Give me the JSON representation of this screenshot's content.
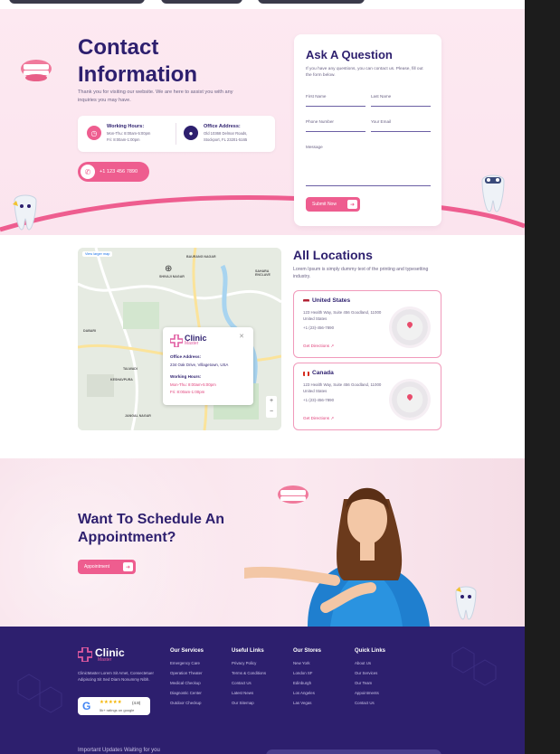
{
  "contact": {
    "title_line1": "Contact",
    "title_line2": "Information",
    "subtitle": "Thank you for visiting our website. We are here to assist you with any inquiries you may have.",
    "working_hours": {
      "title": "Working Hours:",
      "line1": "Mon-Thu: 8:00am-5:00pm",
      "line2": "Fri: 8:00am-1:00pm"
    },
    "office_address": {
      "title": "Office Address:",
      "line1": "Old 10368 Delmar Roads,",
      "line2": "Stockport, FL 23201-5165"
    },
    "phone": "+1 123 456 7890"
  },
  "form": {
    "title": "Ask A Question",
    "subtitle": "If you have any questions, you can contact us. Please, fill out the form below.",
    "first_name": "First Name",
    "last_name": "Last Name",
    "phone_number": "Phone Number",
    "email": "Your Email",
    "message": "Message",
    "submit": "Submit Now"
  },
  "map": {
    "view_larger": "View larger map",
    "labels": [
      "BAURANG NAGAR",
      "SAHARA ENCLAVE",
      "DABARI",
      "TALWADI",
      "KESHAVPURA",
      "JANGAL NAGAR",
      "SHIVAJI NAGAR"
    ],
    "popup": {
      "brand": "Clinic",
      "brand_sub": "Master",
      "office_label": "Office Address:",
      "office_value": "234 Oak Drive, Villagetown, USA",
      "hours_label": "Working Hours:",
      "hours_line1": "Mon-Thu: 8:00am-5:00pm",
      "hours_line2": "Fri: 8:00am-1:00pm"
    }
  },
  "locations": {
    "title": "All Locations",
    "subtitle": "Lorem Ipsum is simply dummy text of the printing and typesetting industry.",
    "items": [
      {
        "name": "United States",
        "address": "123 Health Way, Suite 456 Goodland, 11000 United States",
        "phone": "+1 (23)-456-7890",
        "directions": "Get Directions ↗"
      },
      {
        "name": "Canada",
        "address": "123 Health Way, Suite 456 Goodland, 11000 United States",
        "phone": "+1 (23)-456-7890",
        "directions": "Get Directions ↗"
      }
    ]
  },
  "appointment": {
    "title_line1": "Want To Schedule An",
    "title_line2": "Appointment?",
    "button": "Appointment"
  },
  "footer": {
    "brand": "Clinic",
    "brand_sub": "Master",
    "description": "ClinicMaster Lorem Sit Amet, Consectetuer Adipiscing Sit Sed Diam Nonummy Nibh.",
    "google": {
      "rating": "(4.8)",
      "stars": "★★★★★",
      "text": "5k+ ratings on google"
    },
    "columns": [
      {
        "heading": "Our Services",
        "items": [
          "Emergency Care",
          "Operation Theater",
          "Medical Checkup",
          "Diagnostic Center",
          "Outdoor Checkup"
        ]
      },
      {
        "heading": "Useful Links",
        "items": [
          "Privacy Policy",
          "Terms & Conditions",
          "Contact Us",
          "Latest News",
          "Our Sitemap"
        ]
      },
      {
        "heading": "Our Stores",
        "items": [
          "New York",
          "London SF",
          "Edinburgh",
          "Los Angeles",
          "Las Vegas"
        ]
      },
      {
        "heading": "Quick Links",
        "items": [
          "About Us",
          "Our Services",
          "Our Team",
          "Appointments",
          "Contact Us"
        ]
      }
    ],
    "bottom_text": "Important Updates Waiting for you"
  },
  "colors": {
    "primary": "#2d1f6e",
    "accent": "#ee5d8f",
    "soft_pink": "#fde9f1"
  }
}
